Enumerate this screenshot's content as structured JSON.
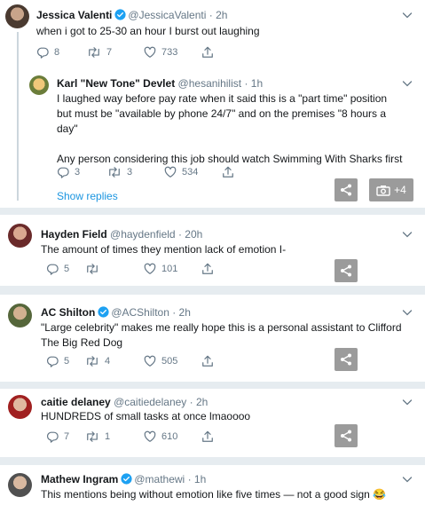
{
  "tweets": [
    {
      "name": "Jessica Valenti",
      "handle": "@JessicaValenti",
      "time": "· 2h",
      "verified": true,
      "text": "when i got to 25-30 an hour I burst out laughing",
      "replies": "8",
      "retweets": "7",
      "likes": "733"
    },
    {
      "name": "Karl \"New Tone\" Devlet",
      "handle": "@hesanihilist",
      "time": "· 1h",
      "text_lines": [
        "I laughed way before pay rate when it said this is a \"part time\" position",
        "but must be \"available by phone 24/7\" and on the premises \"8 hours a",
        "day\""
      ],
      "text2": "Any person considering this job should watch Swimming With Sharks first",
      "replies": "3",
      "retweets": "3",
      "likes": "534",
      "show_replies": "Show replies",
      "photo_count": "+4"
    },
    {
      "name": "Hayden Field",
      "handle": "@haydenfield",
      "time": "· 20h",
      "text": "The amount of times they mention lack of emotion I-",
      "replies": "5",
      "retweets": "",
      "likes": "101"
    },
    {
      "name": "AC Shilton",
      "handle": "@ACShilton",
      "time": "· 2h",
      "verified": true,
      "text_lines": [
        "\"Large celebrity\" makes me really hope this is a personal assistant to Clifford",
        "The Big Red Dog"
      ],
      "replies": "5",
      "retweets": "4",
      "likes": "505"
    },
    {
      "name": "caitie delaney",
      "handle": "@caitiedelaney",
      "time": "· 2h",
      "text": "HUNDREDS of small tasks at once lmaoooo",
      "replies": "7",
      "retweets": "1",
      "likes": "610"
    },
    {
      "name": "Mathew Ingram",
      "handle": "@mathewi",
      "time": "· 1h",
      "verified": true,
      "text": "This mentions being without emotion like five times — not a good sign",
      "emoji": "😂"
    }
  ],
  "colors": {
    "accent": "#1b95e0",
    "verified": "#1da1f2",
    "muted": "#657786",
    "share_bg": "#9b9b9b"
  }
}
